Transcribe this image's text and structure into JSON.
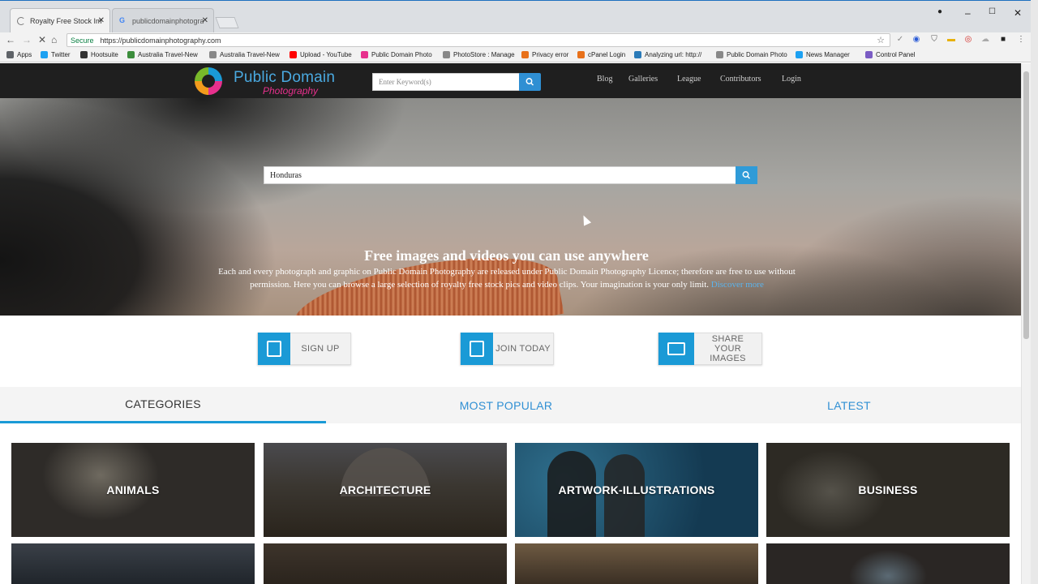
{
  "browser": {
    "tabs": [
      {
        "title": "Royalty Free Stock Image",
        "active": true
      },
      {
        "title": "publicdomainphotograp",
        "active": false
      }
    ],
    "secure_label": "Secure",
    "url": "https://publicdomainphotography.com",
    "bookmarks": [
      {
        "label": "Apps",
        "color": "#5f6368"
      },
      {
        "label": "Twitter",
        "color": "#1da1f2"
      },
      {
        "label": "Hootsuite",
        "color": "#333333"
      },
      {
        "label": "Australia Travel-New",
        "color": "#3c8d3c"
      },
      {
        "label": "Australia Travel-New",
        "color": "#888888"
      },
      {
        "label": "Upload - YouTube",
        "color": "#ff0000"
      },
      {
        "label": "Public Domain Photo",
        "color": "#e7308d"
      },
      {
        "label": "PhotoStore : Manage",
        "color": "#888888"
      },
      {
        "label": "Privacy error",
        "color": "#e8711a"
      },
      {
        "label": "cPanel Login",
        "color": "#e8711a"
      },
      {
        "label": "Analyzing url: http://",
        "color": "#2a7ab8"
      },
      {
        "label": "Public Domain Photo",
        "color": "#888888"
      },
      {
        "label": "News Manager",
        "color": "#1da1f2"
      },
      {
        "label": "Control Panel",
        "color": "#7a5cc4"
      }
    ]
  },
  "header": {
    "logo_line1": "Public Domain",
    "logo_line2": "Photography",
    "search_placeholder": "Enter Keyword(s)",
    "nav": [
      "Blog",
      "Galleries",
      "League",
      "Contributors",
      "Login"
    ]
  },
  "hero": {
    "search_value": "Honduras",
    "title": "Free images and videos you can use anywhere",
    "description": "Each and every photograph and graphic on Public Domain Photography are released under Public Domain Photography Licence; therefore are free to use without permission. Here you can browse a large selection of royalty free stock pics and video clips. Your imagination is your only limit.",
    "link_text": "Discover more"
  },
  "actions": [
    {
      "label": "SIGN UP",
      "icon": "signup-icon"
    },
    {
      "label": "JOIN TODAY",
      "icon": "join-icon"
    },
    {
      "label": "SHARE YOUR IMAGES",
      "icon": "share-icon"
    }
  ],
  "tabs": {
    "categories": "CATEGORIES",
    "most_popular": "MOST POPULAR",
    "latest": "LATEST"
  },
  "categories": [
    "ANIMALS",
    "ARCHITECTURE",
    "ARTWORK-ILLUSTRATIONS",
    "BUSINESS"
  ],
  "colors": {
    "accent": "#1a9ad6",
    "link": "#2f8fd3",
    "header_bg": "#1f1f1f"
  }
}
